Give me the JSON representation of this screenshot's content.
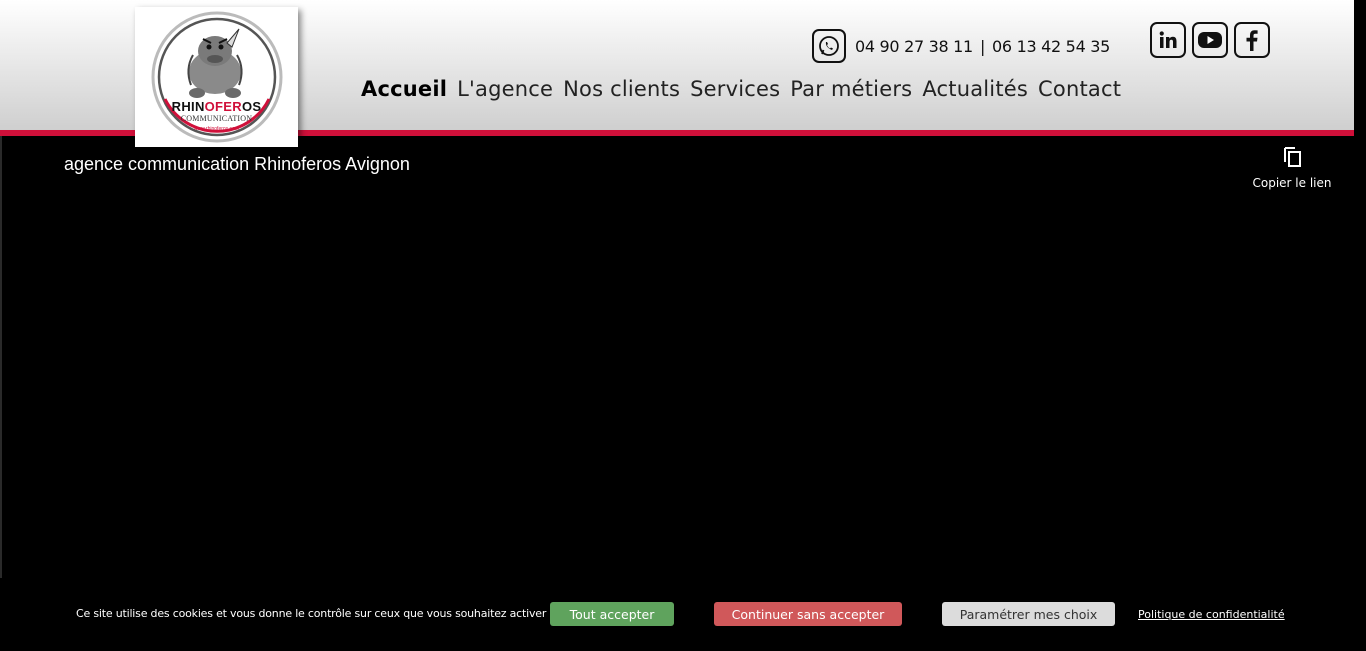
{
  "header": {
    "logo": {
      "main_black": "RHIN",
      "main_red": "OFER",
      "main_end": "OS",
      "sub": "COMMUNICATION",
      "url": "www.rhinoferos.com"
    },
    "phone": {
      "icon": "whatsapp-icon",
      "number1": "04 90 27 38 11",
      "separator": "|",
      "number2": "06 13 42 54 35"
    },
    "social": [
      {
        "icon": "linkedin-icon"
      },
      {
        "icon": "youtube-icon"
      },
      {
        "icon": "facebook-icon"
      }
    ],
    "nav": [
      {
        "label": "Accueil",
        "active": true
      },
      {
        "label": "L'agence"
      },
      {
        "label": "Nos clients"
      },
      {
        "label": "Services"
      },
      {
        "label": "Par métiers"
      },
      {
        "label": "Actualités"
      },
      {
        "label": "Contact"
      }
    ],
    "accent_color": "#d0103a"
  },
  "video": {
    "title": "agence communication Rhinoferos Avignon",
    "copy_icon": "copy-icon",
    "copy_label": "Copier le lien"
  },
  "cookie": {
    "text": "Ce site utilise des cookies et vous donne le contrôle sur ceux que vous souhaitez activer",
    "accept": "Tout accepter",
    "deny": "Continuer sans accepter",
    "params": "Paramétrer mes choix",
    "privacy": "Politique de confidentialité",
    "colors": {
      "accept": "#5fa35d",
      "deny": "#d0585a",
      "params": "#dcdcdc"
    }
  }
}
